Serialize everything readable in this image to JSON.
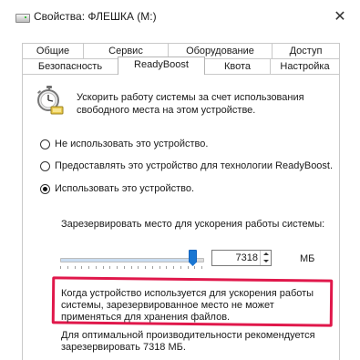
{
  "window": {
    "title": "Свойства: ФЛЕШКА (M:)",
    "close_glyph": "✕",
    "drive_icon": "usb-drive-icon"
  },
  "tabs": {
    "row1": [
      {
        "label": "Общие"
      },
      {
        "label": "Сервис"
      },
      {
        "label": "Оборудование"
      },
      {
        "label": "Доступ"
      }
    ],
    "row2": [
      {
        "label": "Безопасность"
      },
      {
        "label": "ReadyBoost",
        "selected": true
      },
      {
        "label": "Квота"
      },
      {
        "label": "Настройка"
      }
    ]
  },
  "readyboost": {
    "icon": "readyboost-stopwatch-icon",
    "description": "Ускорить работу системы за счет использования свободного места на этом устройстве.",
    "options": [
      {
        "label": "Не использовать это устройство.",
        "checked": false
      },
      {
        "label": "Предоставлять это устройство для технологии ReadyBoost.",
        "checked": false
      },
      {
        "label": "Использовать это устройство.",
        "checked": true
      }
    ],
    "reserve_label": "Зарезервировать место для ускорения работы системы:",
    "slider_fraction": 0.93,
    "spin_value": "7318",
    "unit": "МБ",
    "note_highlighted": "Когда устройство используется для ускорения работы системы, зарезервированное место не может применяться для хранения файлов.",
    "recommendation": "Для оптимальной производительности рекомендуется зарезервировать 7318 МБ."
  },
  "colors": {
    "annotation": "#e0184b",
    "slider_thumb": "#1976d2"
  }
}
